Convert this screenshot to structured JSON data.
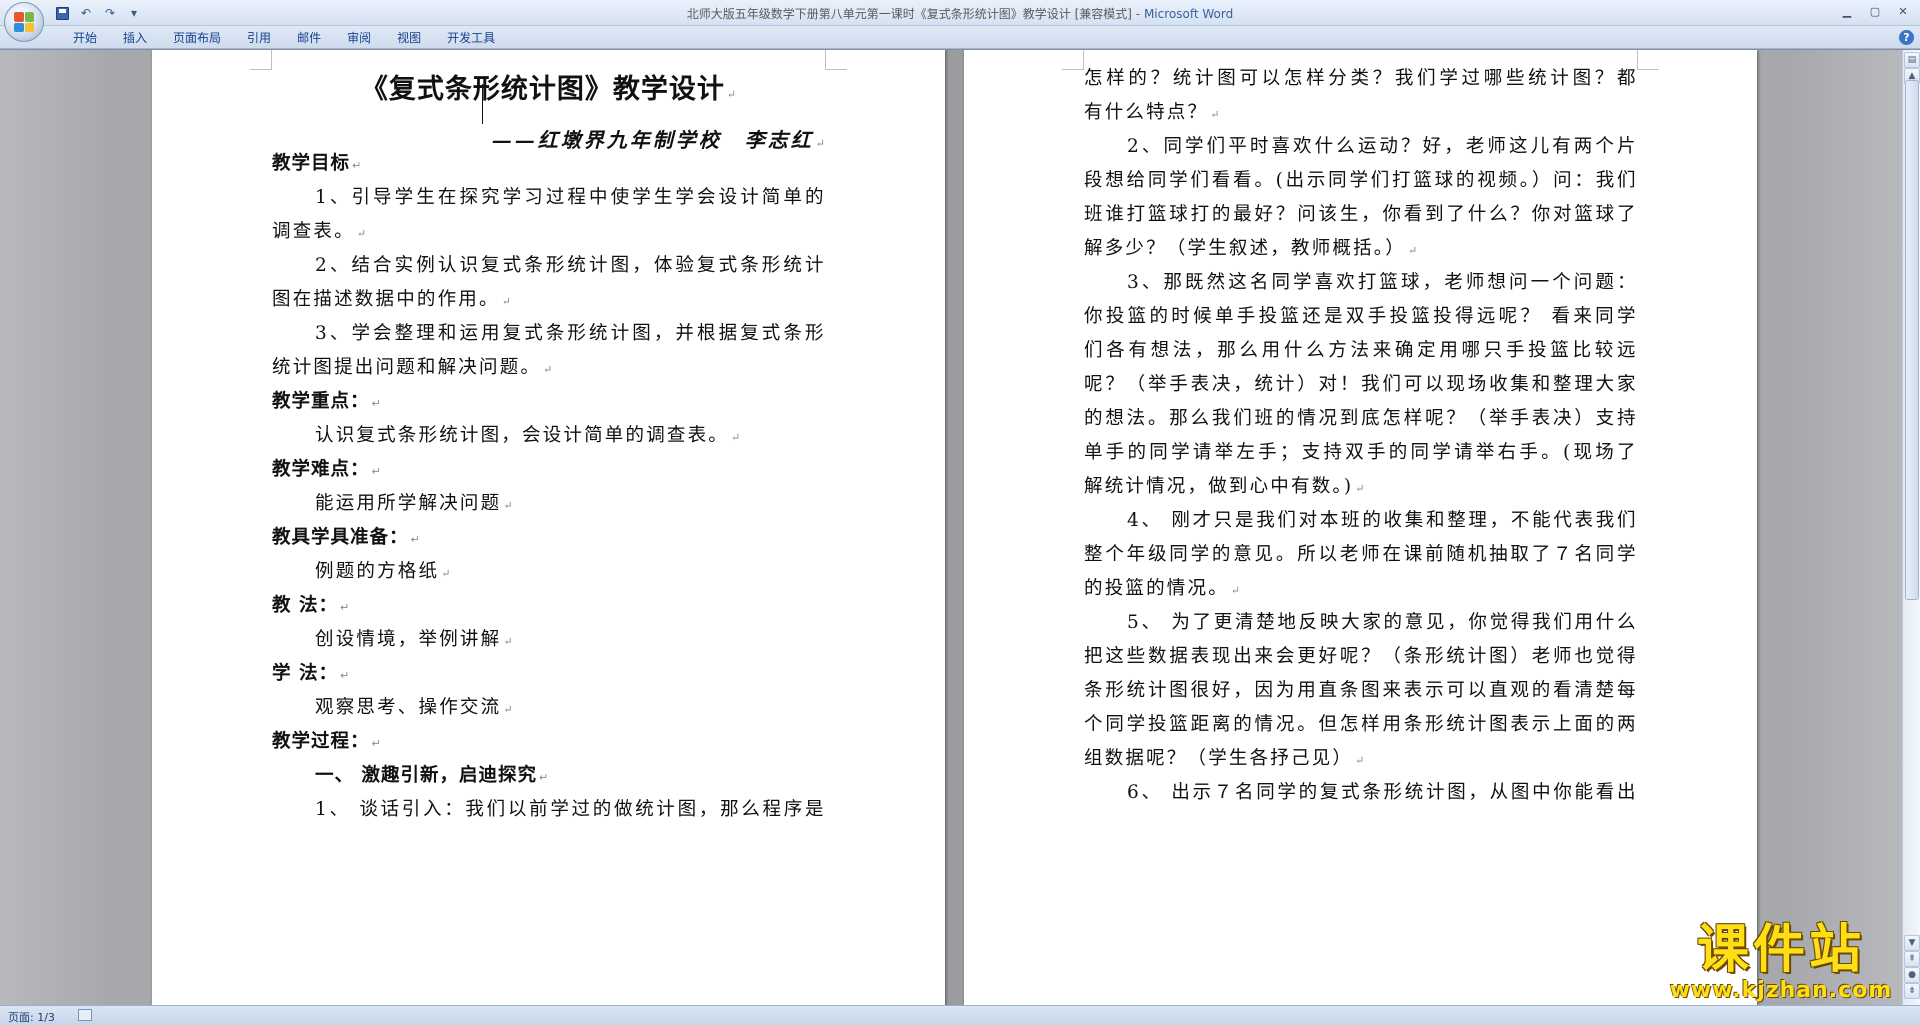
{
  "window": {
    "title": "北师大版五年级数学下册第八单元第一课时《复式条形统计图》教学设计 [兼容模式]",
    "app": "Microsoft Word",
    "minimize_icon": "minimize-icon",
    "maximize_icon": "maximize-icon",
    "close_icon": "close-icon"
  },
  "quick_access": {
    "save": "save-icon",
    "undo": "↶",
    "redo": "↷",
    "more": "▾"
  },
  "ribbon": {
    "tabs": [
      "开始",
      "插入",
      "页面布局",
      "引用",
      "邮件",
      "审阅",
      "视图",
      "开发工具"
    ],
    "help": "?"
  },
  "doc": {
    "title": "《复式条形统计图》教学设计",
    "byline": "——红墩界九年制学校　李志红",
    "left_lines": [
      {
        "text": "教学目标",
        "type": "heading"
      },
      {
        "text": "1、引导学生在探究学习过程中使学生学会设计简单的",
        "type": "indent-justify"
      },
      {
        "text": "调查表。",
        "type": "plain"
      },
      {
        "text": "2、结合实例认识复式条形统计图，体验复式条形统计",
        "type": "indent-justify"
      },
      {
        "text": "图在描述数据中的作用。",
        "type": "plain"
      },
      {
        "text": "3、学会整理和运用复式条形统计图，并根据复式条形",
        "type": "indent-justify"
      },
      {
        "text": "统计图提出问题和解决问题。",
        "type": "plain"
      },
      {
        "text": "教学重点：",
        "type": "heading"
      },
      {
        "text": "认识复式条形统计图，会设计简单的调查表。",
        "type": "indent"
      },
      {
        "text": "教学难点：",
        "type": "heading"
      },
      {
        "text": "能运用所学解决问题",
        "type": "indent"
      },
      {
        "text": "教具学具准备：",
        "type": "heading"
      },
      {
        "text": "例题的方格纸",
        "type": "indent"
      },
      {
        "text": "教 法：",
        "type": "heading"
      },
      {
        "text": "创设情境，举例讲解",
        "type": "indent"
      },
      {
        "text": "学 法：",
        "type": "heading"
      },
      {
        "text": "观察思考、操作交流",
        "type": "indent"
      },
      {
        "text": "教学过程：",
        "type": "heading"
      },
      {
        "text": "一、 激趣引新，启迪探究",
        "type": "indent-heading"
      },
      {
        "text": "1、 谈话引入：我们以前学过的做统计图，那么程序是",
        "type": "indent-justify"
      }
    ],
    "right_lines": [
      {
        "text": "怎样的？统计图可以怎样分类？我们学过哪些统计图？都",
        "type": "justify"
      },
      {
        "text": "有什么特点？",
        "type": "plain"
      },
      {
        "text": "2、同学们平时喜欢什么运动？好，老师这儿有两个片",
        "type": "indent-justify"
      },
      {
        "text": "段想给同学们看看。(出示同学们打篮球的视频。）问：我们",
        "type": "justify"
      },
      {
        "text": "班谁打篮球打的最好？问该生，你看到了什么？你对篮球了",
        "type": "justify"
      },
      {
        "text": "解多少？（学生叙述，教师概括。）",
        "type": "plain"
      },
      {
        "text": "3、那既然这名同学喜欢打篮球，老师想问一个问题：",
        "type": "indent-justify"
      },
      {
        "text": "你投篮的时候单手投篮还是双手投篮投得远呢？ 看来同学",
        "type": "justify"
      },
      {
        "text": "们各有想法，那么用什么方法来确定用哪只手投篮比较远",
        "type": "justify"
      },
      {
        "text": "呢？（举手表决，统计）对！我们可以现场收集和整理大家",
        "type": "justify"
      },
      {
        "text": "的想法。那么我们班的情况到底怎样呢？（举手表决）支持",
        "type": "justify"
      },
      {
        "text": "单手的同学请举左手；支持双手的同学请举右手。(现场了",
        "type": "justify"
      },
      {
        "text": "解统计情况，做到心中有数。)",
        "type": "plain"
      },
      {
        "text": "4、 刚才只是我们对本班的收集和整理，不能代表我们",
        "type": "indent-justify"
      },
      {
        "text": "整个年级同学的意见。所以老师在课前随机抽取了７名同学",
        "type": "justify"
      },
      {
        "text": "的投篮的情况。",
        "type": "plain"
      },
      {
        "text": "5、 为了更清楚地反映大家的意见，你觉得我们用什么",
        "type": "indent-justify"
      },
      {
        "text": "把这些数据表现出来会更好呢？（条形统计图）老师也觉得",
        "type": "justify"
      },
      {
        "text": "条形统计图很好，因为用直条图来表示可以直观的看清楚每",
        "type": "justify"
      },
      {
        "text": "个同学投篮距离的情况。但怎样用条形统计图表示上面的两",
        "type": "justify"
      },
      {
        "text": "组数据呢？（学生各抒己见）",
        "type": "plain"
      },
      {
        "text": "6、 出示７名同学的复式条形统计图，从图中你能看出",
        "type": "indent-justify"
      }
    ]
  },
  "status": {
    "page": "页面: 1/3"
  },
  "watermark": {
    "name": "课件站",
    "url": "www.kjzhan.com"
  },
  "colors": {
    "ribbon_text": "#15428b",
    "watermark": "#ffde17",
    "workspace": "#9a9ca0"
  }
}
